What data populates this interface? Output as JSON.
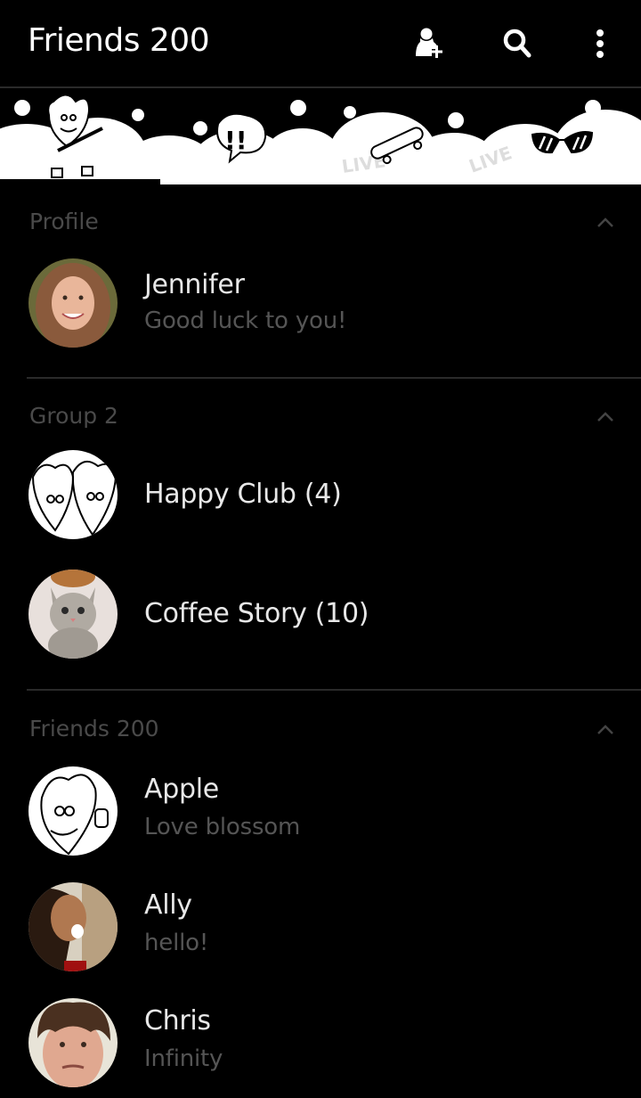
{
  "header": {
    "title": "Friends 200",
    "actions": [
      {
        "name": "add-friend",
        "icon": "add-person-icon"
      },
      {
        "name": "search",
        "icon": "search-icon"
      },
      {
        "name": "more",
        "icon": "more-vert-icon"
      }
    ]
  },
  "banner": {
    "description": "Cartoon doodle banner with clouds, heart guitarist, speech bubble, skateboard, sunglasses"
  },
  "sections": [
    {
      "title": "Profile",
      "expanded": true,
      "items": [
        {
          "name": "Jennifer",
          "status": "Good luck to you!",
          "avatar": "photo-woman-smiling"
        }
      ]
    },
    {
      "title": "Group 2",
      "expanded": true,
      "items": [
        {
          "name": "Happy Club (4)",
          "avatar": "cartoon-two-hearts"
        },
        {
          "name": "Coffee Story (10)",
          "avatar": "photo-tabby-cat"
        }
      ]
    },
    {
      "title": "Friends 200",
      "expanded": true,
      "items": [
        {
          "name": "Apple",
          "status": "Love blossom",
          "avatar": "cartoon-heart-thumbs-up"
        },
        {
          "name": "Ally",
          "status": "hello!",
          "avatar": "photo-laughing-woman"
        },
        {
          "name": "Chris",
          "status": "Infinity",
          "avatar": "photo-young-man"
        }
      ]
    }
  ],
  "colors": {
    "background": "#000000",
    "primary_text": "#e8e8e8",
    "secondary_text": "#555555",
    "section_header": "#4a4a4a",
    "divider": "#2a2a2a"
  }
}
